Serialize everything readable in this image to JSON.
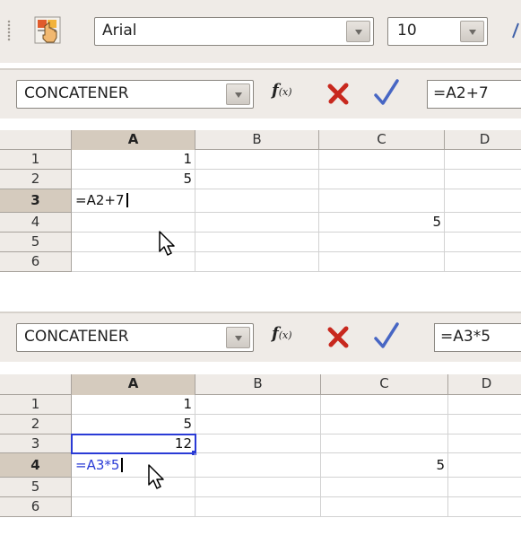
{
  "toolbar": {
    "font_name": "Arial",
    "font_size": "10"
  },
  "panel1": {
    "name_box": "CONCATENER",
    "fx_label": "f",
    "fx_sub": "(x)",
    "formula": "=A2+7",
    "columns": [
      "A",
      "B",
      "C",
      "D"
    ],
    "rows": [
      "1",
      "2",
      "3",
      "4",
      "5",
      "6"
    ],
    "cells": {
      "A1": "1",
      "A2": "5",
      "A3": "=A2+7",
      "C4": "5"
    }
  },
  "panel2": {
    "name_box": "CONCATENER",
    "fx_label": "f",
    "fx_sub": "(x)",
    "formula": "=A3*5",
    "columns": [
      "A",
      "B",
      "C",
      "D"
    ],
    "rows": [
      "1",
      "2",
      "3",
      "4",
      "5",
      "6"
    ],
    "cells": {
      "A1": "1",
      "A2": "5",
      "A3": "12",
      "A4": "=A3*5",
      "C4": "5"
    }
  },
  "colors": {
    "chrome_bg": "#efebe7",
    "header_selected": "#d5cbbe",
    "reference_blue": "#2a3bd6"
  },
  "icons": {
    "toolbar_icon": "hand-pointer-icon",
    "cancel": "cancel-x-icon",
    "accept": "accept-check-icon",
    "pointer": "mouse-pointer-icon"
  }
}
